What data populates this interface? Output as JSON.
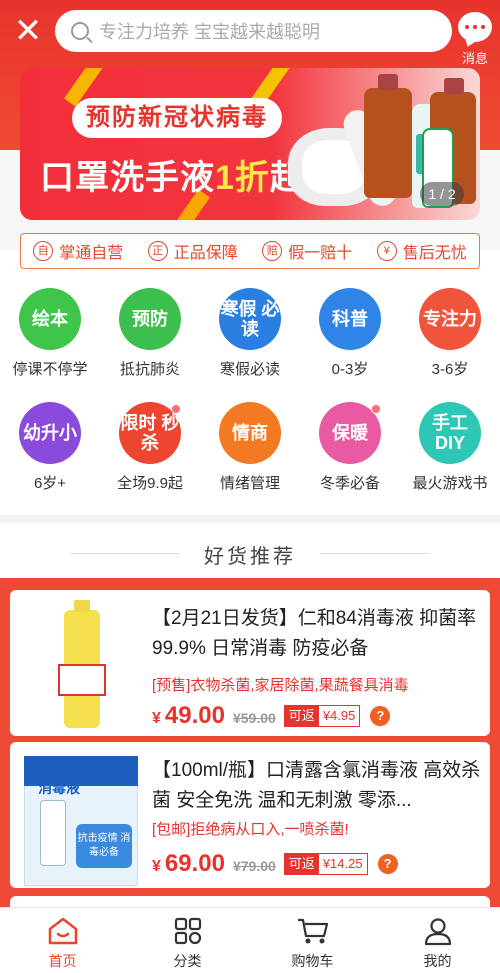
{
  "header": {
    "close_icon": "close-icon",
    "search_placeholder": "专注力培养 宝宝越来越聪明",
    "message_label": "消息"
  },
  "banner": {
    "pill_text": "预防新冠状病毒",
    "main_prefix": "口罩洗手液",
    "main_highlight": "1折",
    "main_suffix": "起",
    "pager": "1 / 2"
  },
  "guarantees": [
    {
      "icon": "自",
      "label": "掌通自营"
    },
    {
      "icon": "正",
      "label": "正品保障"
    },
    {
      "icon": "赔",
      "label": "假一赔十"
    },
    {
      "icon": "¥",
      "label": "售后无忧"
    }
  ],
  "categories": [
    {
      "badge": "绘本",
      "label": "停课不停学",
      "color": "#3fc64a"
    },
    {
      "badge": "预防",
      "label": "抵抗肺炎",
      "color": "#3cbf4e"
    },
    {
      "badge": "寒假 必读",
      "label": "寒假必读",
      "color": "#2a7fe0"
    },
    {
      "badge": "科普",
      "label": "0-3岁",
      "color": "#2f84e6"
    },
    {
      "badge": "专注力",
      "label": "3-6岁",
      "color": "#f0543a"
    },
    {
      "badge": "幼升小",
      "label": "6岁+",
      "color": "#8a4bdc"
    },
    {
      "badge": "限时 秒杀",
      "label": "全场9.9起",
      "color": "#ee4530"
    },
    {
      "badge": "情商",
      "label": "情绪管理",
      "color": "#f37a22"
    },
    {
      "badge": "保暖",
      "label": "冬季必备",
      "color": "#e95aa3"
    },
    {
      "badge": "手工 DIY",
      "label": "最火游戏书",
      "color": "#2ec7b5"
    }
  ],
  "section_title": "好货推荐",
  "products": [
    {
      "title": "【2月21日发货】仁和84消毒液 抑菌率99.9% 日常消毒 防疫必备",
      "subtitle": "[预售]衣物杀菌,家居除菌,果蔬餐具消毒",
      "currency": "¥",
      "price": "49.00",
      "old_price": "¥59.00",
      "rebate_label": "可返",
      "rebate_value": "¥4.95",
      "help": "?"
    },
    {
      "title": "【100ml/瓶】口清露含氯消毒液 高效杀菌 安全免洗 温和无刺激 零添...",
      "subtitle": "[包邮]拒绝病从口入,一喷杀菌!",
      "currency": "¥",
      "price": "69.00",
      "old_price": "¥79.00",
      "rebate_label": "可返",
      "rebate_value": "¥14.25",
      "help": "?",
      "image_badge": "消毒液",
      "image_tag": "抗击疫情 消毒必备"
    }
  ],
  "tabs": [
    {
      "label": "首页",
      "icon": "home-icon",
      "active": true
    },
    {
      "label": "分类",
      "icon": "category-icon",
      "active": false
    },
    {
      "label": "购物车",
      "icon": "cart-icon",
      "active": false
    },
    {
      "label": "我的",
      "icon": "user-icon",
      "active": false
    }
  ],
  "colors": {
    "brand_red": "#e8332d",
    "highlight_yellow": "#ffe84a"
  }
}
